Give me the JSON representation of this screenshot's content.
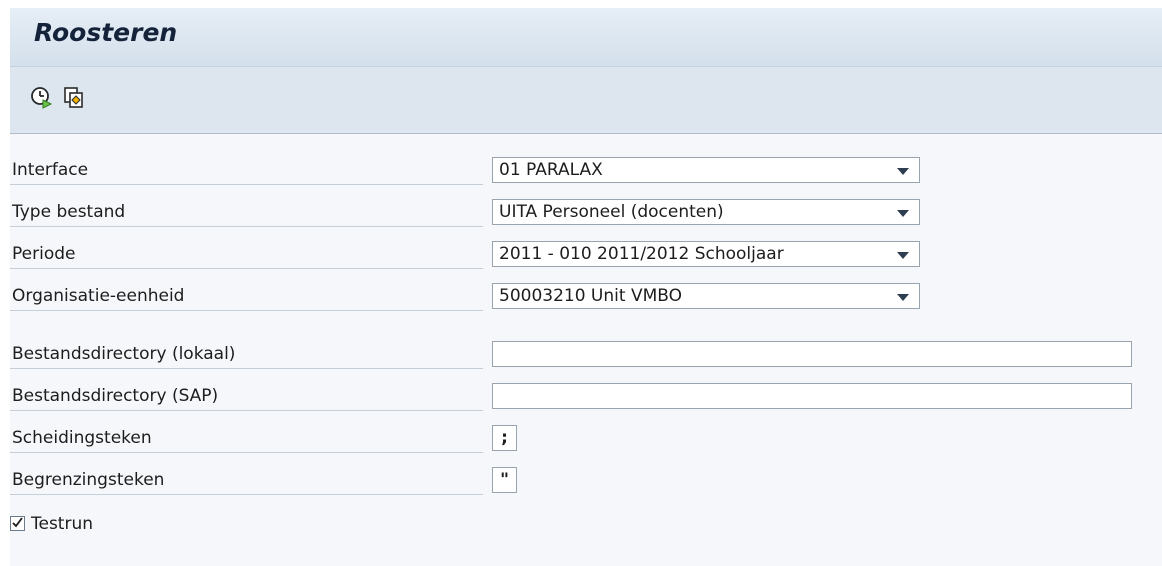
{
  "title": "Roosteren",
  "toolbar": {
    "buttons": [
      {
        "icon": "execute-clock-icon"
      },
      {
        "icon": "variants-icon"
      }
    ]
  },
  "fields": {
    "interface": {
      "label": "Interface",
      "value": "01 PARALAX"
    },
    "type_bestand": {
      "label": "Type bestand",
      "value": "UITA Personeel (docenten)"
    },
    "periode": {
      "label": "Periode",
      "value": "2011 - 010 2011/2012 Schooljaar"
    },
    "organisatie": {
      "label": "Organisatie-eenheid",
      "value": "50003210 Unit VMBO"
    },
    "dir_lokaal": {
      "label": "Bestandsdirectory (lokaal)",
      "value": ""
    },
    "dir_sap": {
      "label": "Bestandsdirectory (SAP)",
      "value": ""
    },
    "scheidingsteken": {
      "label": "Scheidingsteken",
      "value": ";"
    },
    "begrenzingsteken": {
      "label": "Begrenzingsteken",
      "value": "\""
    }
  },
  "testrun": {
    "label": "Testrun",
    "checked": true
  }
}
